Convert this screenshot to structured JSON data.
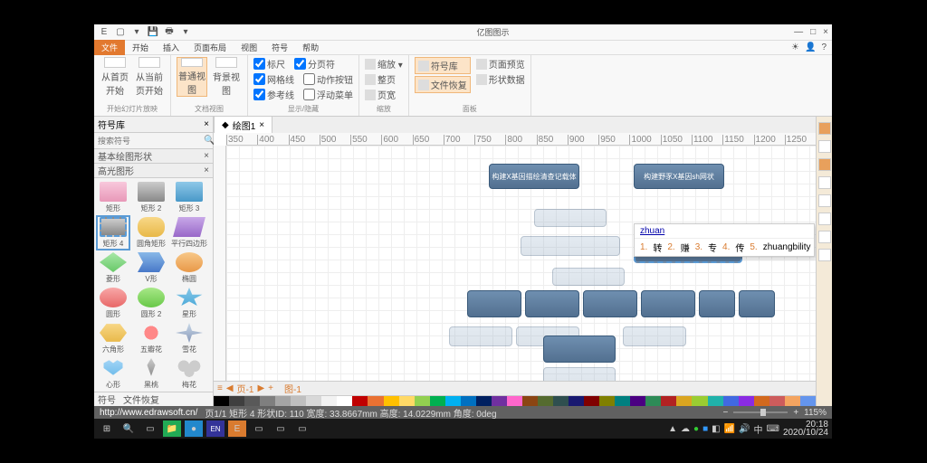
{
  "app_title": "亿图图示",
  "window_buttons": {
    "min": "—",
    "max": "□",
    "close": "×"
  },
  "ribbon_tabs": [
    "文件",
    "开始",
    "插入",
    "页面布局",
    "视图",
    "符号",
    "帮助"
  ],
  "ribbon": {
    "group1": {
      "btn1": "从首页开始",
      "btn2": "从当前页开始",
      "label": "开始幻灯片放映"
    },
    "group2": {
      "btn1": "普通视图",
      "btn2": "背景视图",
      "label": "文档视图"
    },
    "group3": {
      "r1c1": "标尺",
      "r1c2": "分页符",
      "r2c1": "网格线",
      "r2c2": "动作按钮",
      "r3c1": "参考线",
      "r3c2": "浮动菜单",
      "label": "显示/隐藏"
    },
    "group4": {
      "i1": "缩放 ▾",
      "i2": "整页",
      "i3": "页宽",
      "label": "缩放"
    },
    "group5": {
      "i1": "符号库",
      "i2": "文件恢复",
      "i3": "页面预览",
      "i4": "形状数据",
      "label": "面板"
    }
  },
  "sidebar": {
    "title": "符号库",
    "search_ph": "搜索符号",
    "cat1": "基本绘图形状",
    "cat2": "高光图形",
    "shapes": [
      [
        "矩形",
        "矩形 2",
        "矩形 3"
      ],
      [
        "矩形 4",
        "圆角矩形",
        "平行四边形"
      ],
      [
        "菱形",
        "V形",
        "椭圆"
      ],
      [
        "圆形",
        "圆形 2",
        "星形"
      ],
      [
        "六角形",
        "五瓣花",
        "雪花"
      ],
      [
        "心形",
        "黑桃",
        "梅花"
      ]
    ],
    "foot": {
      "a": "符号",
      "b": "文件恢复"
    }
  },
  "doc_tab": "绘图1",
  "ruler_marks": [
    "350",
    "400",
    "450",
    "500",
    "550",
    "600",
    "650",
    "700",
    "750",
    "800",
    "850",
    "900",
    "950",
    "1000",
    "1050",
    "1100",
    "1150",
    "1200",
    "1250"
  ],
  "nodes": {
    "a": "构建X基因描绘清查记载体",
    "b": "构建野豕X基因sh网状"
  },
  "ime": {
    "typed": "zhuan",
    "cands": [
      [
        "1",
        "转"
      ],
      [
        "2",
        "赚"
      ],
      [
        "3",
        "专"
      ],
      [
        "4",
        "传"
      ],
      [
        "5",
        "zhuangbility"
      ]
    ]
  },
  "page_tabs": {
    "p": "页-1",
    "l": "图-1"
  },
  "colors": [
    "#000",
    "#3f3f3f",
    "#595959",
    "#7f7f7f",
    "#a5a5a5",
    "#bfbfbf",
    "#d8d8d8",
    "#f2f2f2",
    "#fff",
    "#c00000",
    "#e97132",
    "#ffc000",
    "#ffd966",
    "#92d050",
    "#00b050",
    "#00b0f0",
    "#0070c0",
    "#002060",
    "#7030a0",
    "#ff66cc",
    "#8b4513",
    "#556b2f",
    "#2f4f4f",
    "#191970",
    "#800000",
    "#808000",
    "#008080",
    "#4b0082",
    "#2e8b57",
    "#b22222",
    "#daa520",
    "#9acd32",
    "#20b2aa",
    "#4169e1",
    "#8a2be2",
    "#d2691e",
    "#cd5c5c",
    "#f4a460",
    "#6495ed"
  ],
  "status": {
    "url": "http://www.edrawsoft.cn/",
    "info": "页1/1  矩形 4 形状ID: 110  宽度: 33.8667mm 高度: 14.0229mm 角度: 0deg",
    "zoom": "115%"
  },
  "tray": {
    "time": "20:18",
    "date": "2020/10/24",
    "lang": "中"
  }
}
